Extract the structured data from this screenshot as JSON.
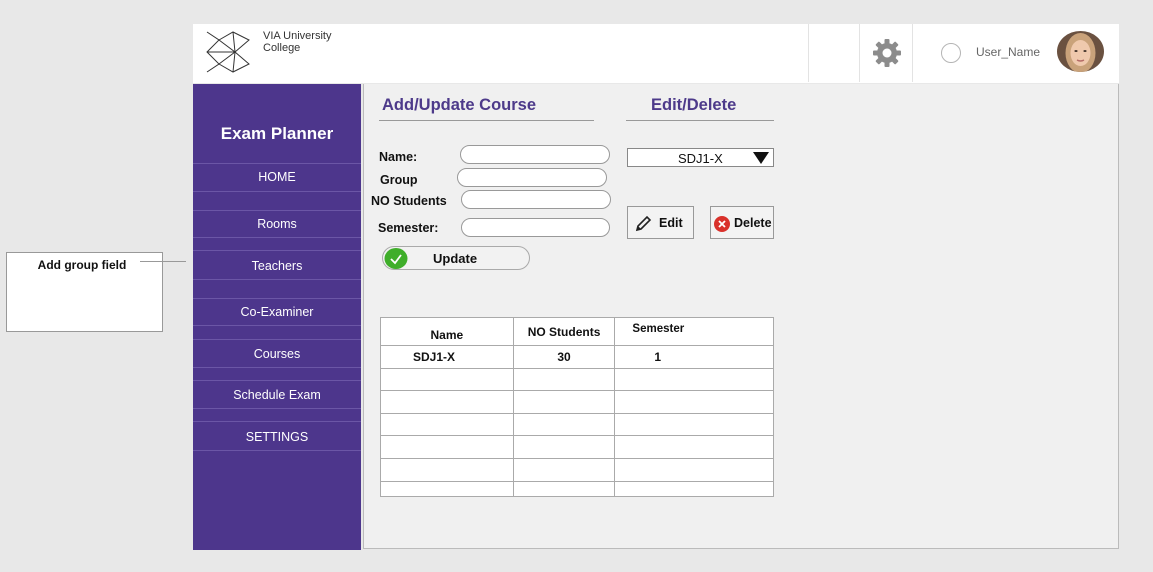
{
  "annotation": {
    "text": "Add group field"
  },
  "header": {
    "brand_line1": "VIA University",
    "brand_line2": "College",
    "username": "User_Name"
  },
  "sidebar": {
    "title": "Exam Planner",
    "items": [
      {
        "label": "HOME"
      },
      {
        "label": "Rooms"
      },
      {
        "label": "Teachers"
      },
      {
        "label": "Co-Examiner"
      },
      {
        "label": "Courses"
      },
      {
        "label": "Schedule Exam"
      },
      {
        "label": "SETTINGS"
      }
    ]
  },
  "form": {
    "heading": "Add/Update Course",
    "name_label": "Name:",
    "group_label": "Group",
    "students_label": "NO Students",
    "semester_label": "Semester:",
    "name_value": "",
    "group_value": "",
    "students_value": "",
    "semester_value": "",
    "update_label": "Update"
  },
  "edit": {
    "heading": "Edit/Delete",
    "selected_course": "SDJ1-X",
    "edit_label": "Edit",
    "delete_label": "Delete"
  },
  "table": {
    "headers": [
      "Name",
      "NO Students",
      "Semester"
    ],
    "rows": [
      [
        "SDJ1-X",
        "30",
        "1"
      ],
      [
        "",
        "",
        ""
      ],
      [
        "",
        "",
        ""
      ],
      [
        "",
        "",
        ""
      ],
      [
        "",
        "",
        ""
      ],
      [
        "",
        "",
        ""
      ],
      [
        "",
        "",
        ""
      ]
    ]
  },
  "colors": {
    "sidebar": "#4d368c",
    "heading": "#4d3a8a",
    "update_check": "#3fae2a",
    "delete_icon": "#d9312b"
  }
}
